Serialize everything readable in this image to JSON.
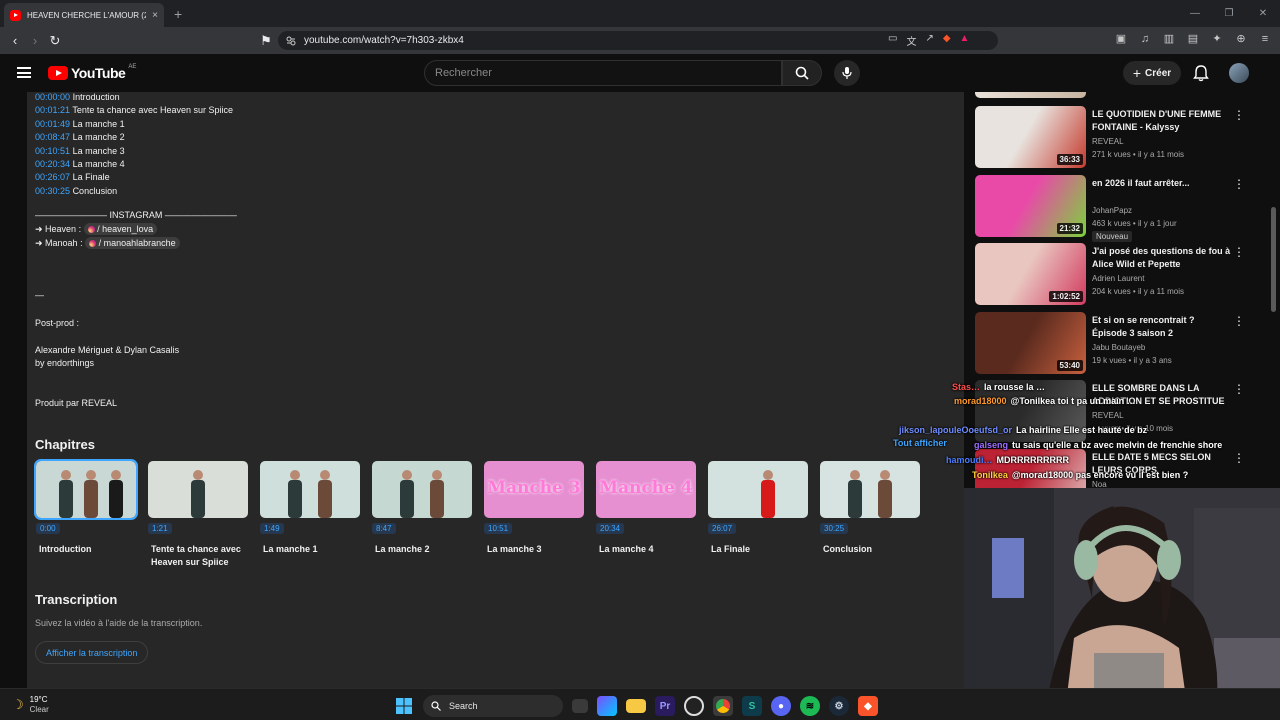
{
  "browser": {
    "tab_title": "HEAVEN CHERCHE L'AMOUR (20",
    "tab_close": "×",
    "new_tab": "+",
    "url": "youtube.com/watch?v=7h303-zkbx4"
  },
  "header": {
    "logo_text": "YouTube",
    "country": "AE",
    "search_placeholder": "Rechercher",
    "create_label": "Créer"
  },
  "description": {
    "chapters_list": [
      {
        "time": "00:00:00",
        "label": "Introduction"
      },
      {
        "time": "00:01:21",
        "label": "Tente ta chance avec Heaven sur Spiice"
      },
      {
        "time": "00:01:49",
        "label": "La manche 1"
      },
      {
        "time": "00:08:47",
        "label": "La manche 2"
      },
      {
        "time": "00:10:51",
        "label": "La manche 3"
      },
      {
        "time": "00:20:34",
        "label": "La manche 4"
      },
      {
        "time": "00:26:07",
        "label": "La Finale"
      },
      {
        "time": "00:30:25",
        "label": "Conclusion"
      }
    ],
    "instagram_header": "———————— INSTAGRAM ————————",
    "instagram": [
      {
        "name": "➜ Heaven :",
        "handle": "/ heaven_lova"
      },
      {
        "name": "➜ Manoah :",
        "handle": "/ manoahlabranche"
      }
    ],
    "separator": "—",
    "postprod_label": "Post-prod :",
    "credits": "Alexandre Mériguet & Dylan Casalis",
    "by": "by endorthings",
    "produced": "Produit par REVEAL"
  },
  "chapters_section": {
    "title": "Chapitres",
    "items": [
      {
        "time": "0:00",
        "title": "Introduction",
        "bg": "#c9d8d4"
      },
      {
        "time": "1:21",
        "title": "Tente ta chance avec Heaven sur Spiice",
        "bg": "#d9ded9"
      },
      {
        "time": "1:49",
        "title": "La manche 1",
        "bg": "#cfe0dc"
      },
      {
        "time": "8:47",
        "title": "La manche 2",
        "bg": "#c5d9d2"
      },
      {
        "time": "10:51",
        "title": "La manche 3",
        "bg": "#e58ed0",
        "overlay": "Manche 3"
      },
      {
        "time": "20:34",
        "title": "La manche 4",
        "bg": "#e68fd1",
        "overlay": "Manche 4"
      },
      {
        "time": "26:07",
        "title": "La Finale",
        "bg": "#d3e2de"
      },
      {
        "time": "30:25",
        "title": "Conclusion",
        "bg": "#d6e3e0"
      }
    ]
  },
  "transcription": {
    "title": "Transcription",
    "subtitle": "Suivez la vidéo à l'aide de la transcription.",
    "button": "Afficher la transcription"
  },
  "recommendations": [
    {
      "title": "LE QUOTIDIEN D'UNE FEMME FONTAINE  - Kalyssy",
      "channel": "REVEAL",
      "meta": "271 k vues • il y a 11 mois",
      "duration": "36:33",
      "badge": "",
      "colors": [
        "#e8e3de",
        "#c43a2e"
      ]
    },
    {
      "title": "en 2026 il faut arrêter...",
      "channel": "JohanPapz",
      "meta": "463 k vues • il y a 1 jour",
      "duration": "21:32",
      "badge": "Nouveau",
      "colors": [
        "#e94aa8",
        "#7bd23a"
      ]
    },
    {
      "title": "J'ai posé des questions de fou à Alice Wild et Pepette",
      "channel": "Adrien Laurent",
      "meta": "204 k vues • il y a 11 mois",
      "duration": "1:02:52",
      "badge": "",
      "colors": [
        "#e9c6c0",
        "#d23a5e"
      ]
    },
    {
      "title": "Et si on se rencontrait ? Épisode 3 saison 2",
      "channel": "Jabu Boutayeb",
      "meta": "19 k vues • il y a 3 ans",
      "duration": "53:40",
      "badge": "",
      "colors": [
        "#5a2a1e",
        "#c7603e"
      ]
    },
    {
      "title": "ELLE SOMBRE DANS LA ADDICTION ET SE PROSTITUE",
      "channel": "REVEAL",
      "meta": "… vues • il y a 10 mois",
      "duration": "",
      "badge": "",
      "colors": [
        "#2b2b2b",
        "#5a5a5a"
      ]
    },
    {
      "title": "ELLE DATE 5 MECS SELON LEURS CORPS",
      "channel": "Noa",
      "meta": "",
      "duration": "",
      "badge": "",
      "colors": [
        "#bb2233",
        "#e0c0c0"
      ]
    }
  ],
  "chat": [
    {
      "user": "Stas…",
      "msg": "la rousse la …",
      "ucolor": "#ff4d4d"
    },
    {
      "user": "morad18000",
      "msg": "@Tonilkea toi t pa un main …",
      "ucolor": "#ff9a2e"
    },
    {
      "user": "jikson_lapouleOoeufsd_or",
      "msg": "La hairline Elle est hauté de bz",
      "ucolor": "#6f8dff"
    },
    {
      "user": "Tout afficher",
      "msg": "",
      "ucolor": "#3ea6ff"
    },
    {
      "user": "galseng",
      "msg": "tu sais qu'elle a bz avec melvin de frenchie shore",
      "ucolor": "#9d6fff"
    },
    {
      "user": "hamoudi…",
      "msg": "MDRRRRRRRRR",
      "ucolor": "#4d7dff"
    },
    {
      "user": "ToniIkea",
      "msg": "@morad18000 pas encore vu il est bien ?",
      "ucolor": "#ffd23e"
    }
  ],
  "taskbar": {
    "temp": "19°C",
    "condition": "Clear",
    "search_label": "Search"
  }
}
